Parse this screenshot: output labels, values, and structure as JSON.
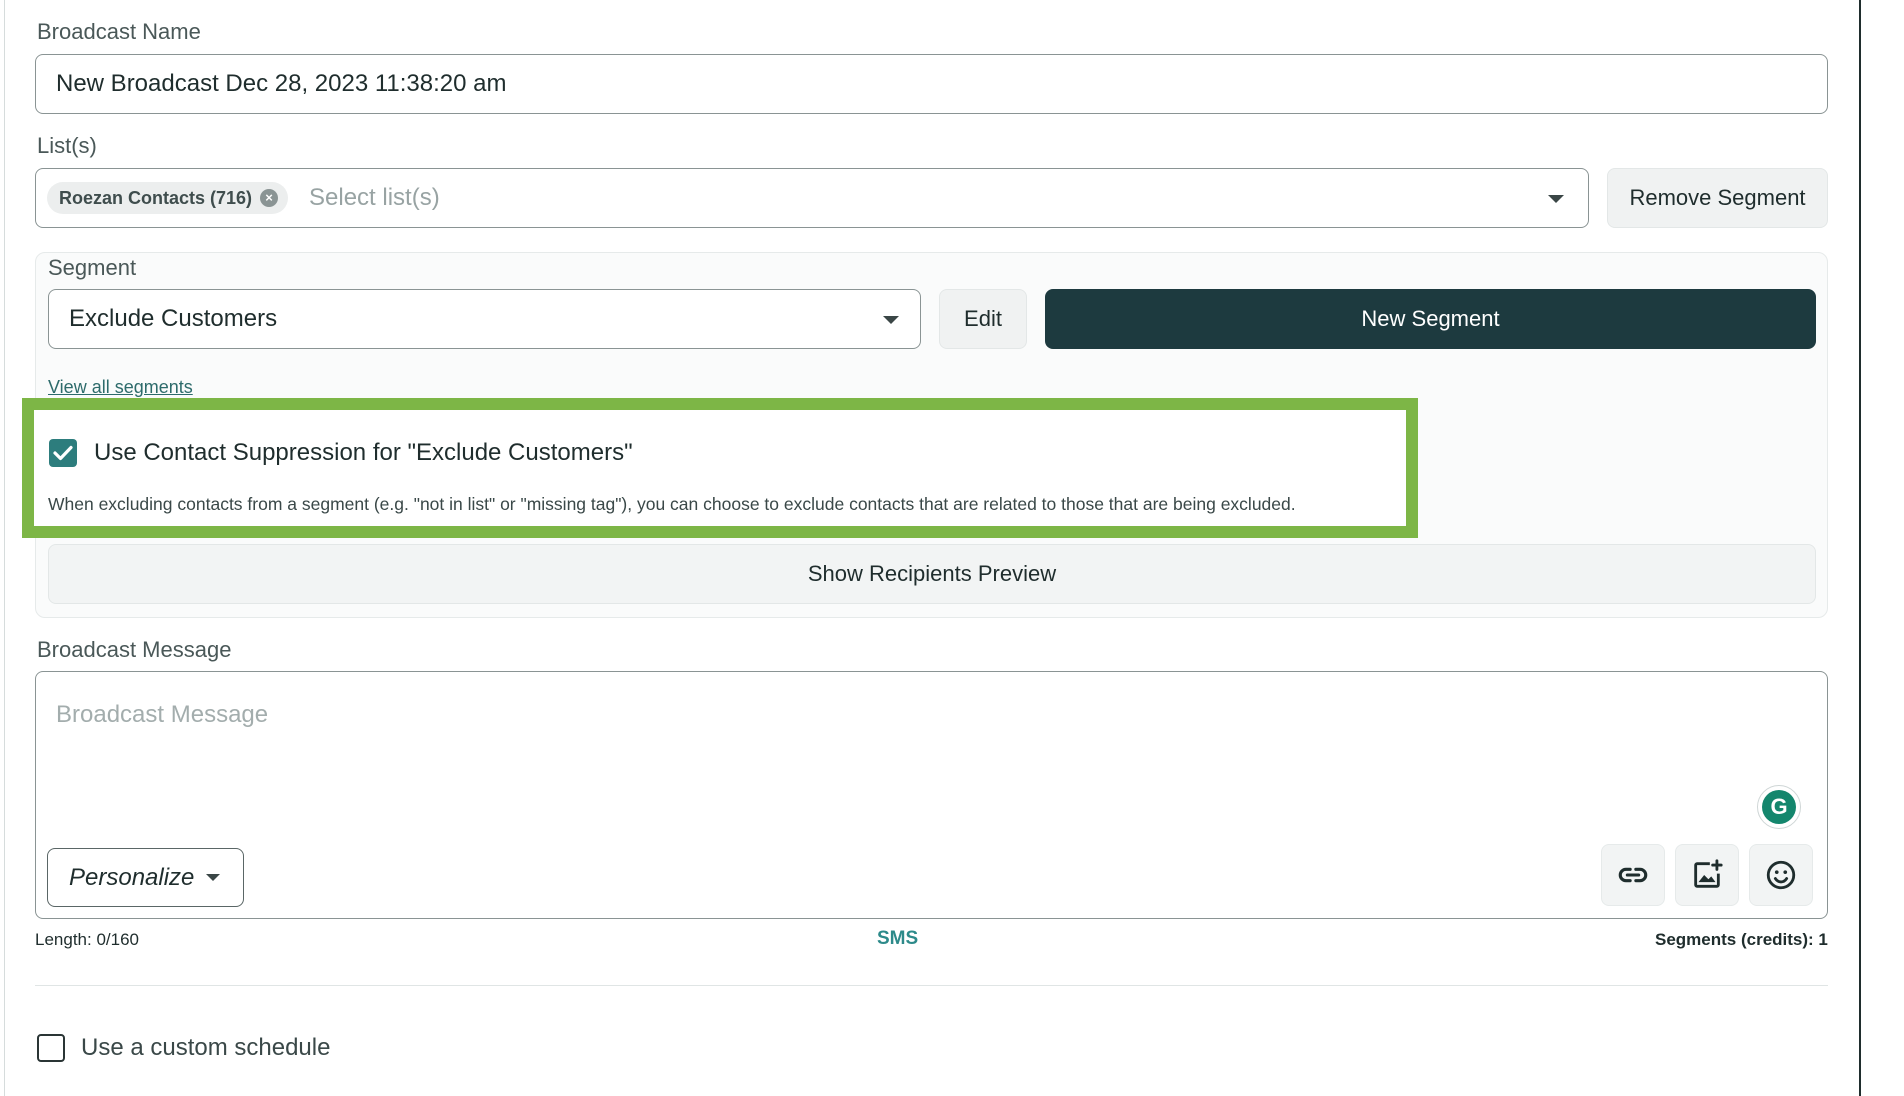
{
  "broadcast_name": {
    "label": "Broadcast Name",
    "value": "New Broadcast Dec 28, 2023 11:38:20 am"
  },
  "lists": {
    "label": "List(s)",
    "selected_chip": "Roezan Contacts (716)",
    "placeholder": "Select list(s)",
    "remove_segment_label": "Remove Segment"
  },
  "segment": {
    "label": "Segment",
    "selected": "Exclude Customers",
    "edit_label": "Edit",
    "new_segment_label": "New Segment",
    "view_all_link": "View all segments",
    "suppression_checked": true,
    "suppression_label": "Use Contact Suppression for \"Exclude Customers\"",
    "suppression_help": "When excluding contacts from a segment (e.g. \"not in list\" or \"missing tag\"), you can choose to exclude contacts that are related to those that are being excluded.",
    "preview_label": "Show Recipients Preview"
  },
  "message": {
    "label": "Broadcast Message",
    "placeholder": "Broadcast Message",
    "personalize_label": "Personalize",
    "length": "Length: 0/160",
    "type": "SMS",
    "segments_credits": "Segments (credits): 1",
    "toolbar_icons": [
      "link-icon",
      "add-image-icon",
      "emoji-icon"
    ]
  },
  "schedule": {
    "custom_schedule_label": "Use a custom schedule",
    "checked": false
  },
  "colors": {
    "dark_button": "#1d3a3f",
    "highlight": "#7db646",
    "checkbox": "#2d7d7d",
    "sms_label": "#2d8a8a"
  }
}
